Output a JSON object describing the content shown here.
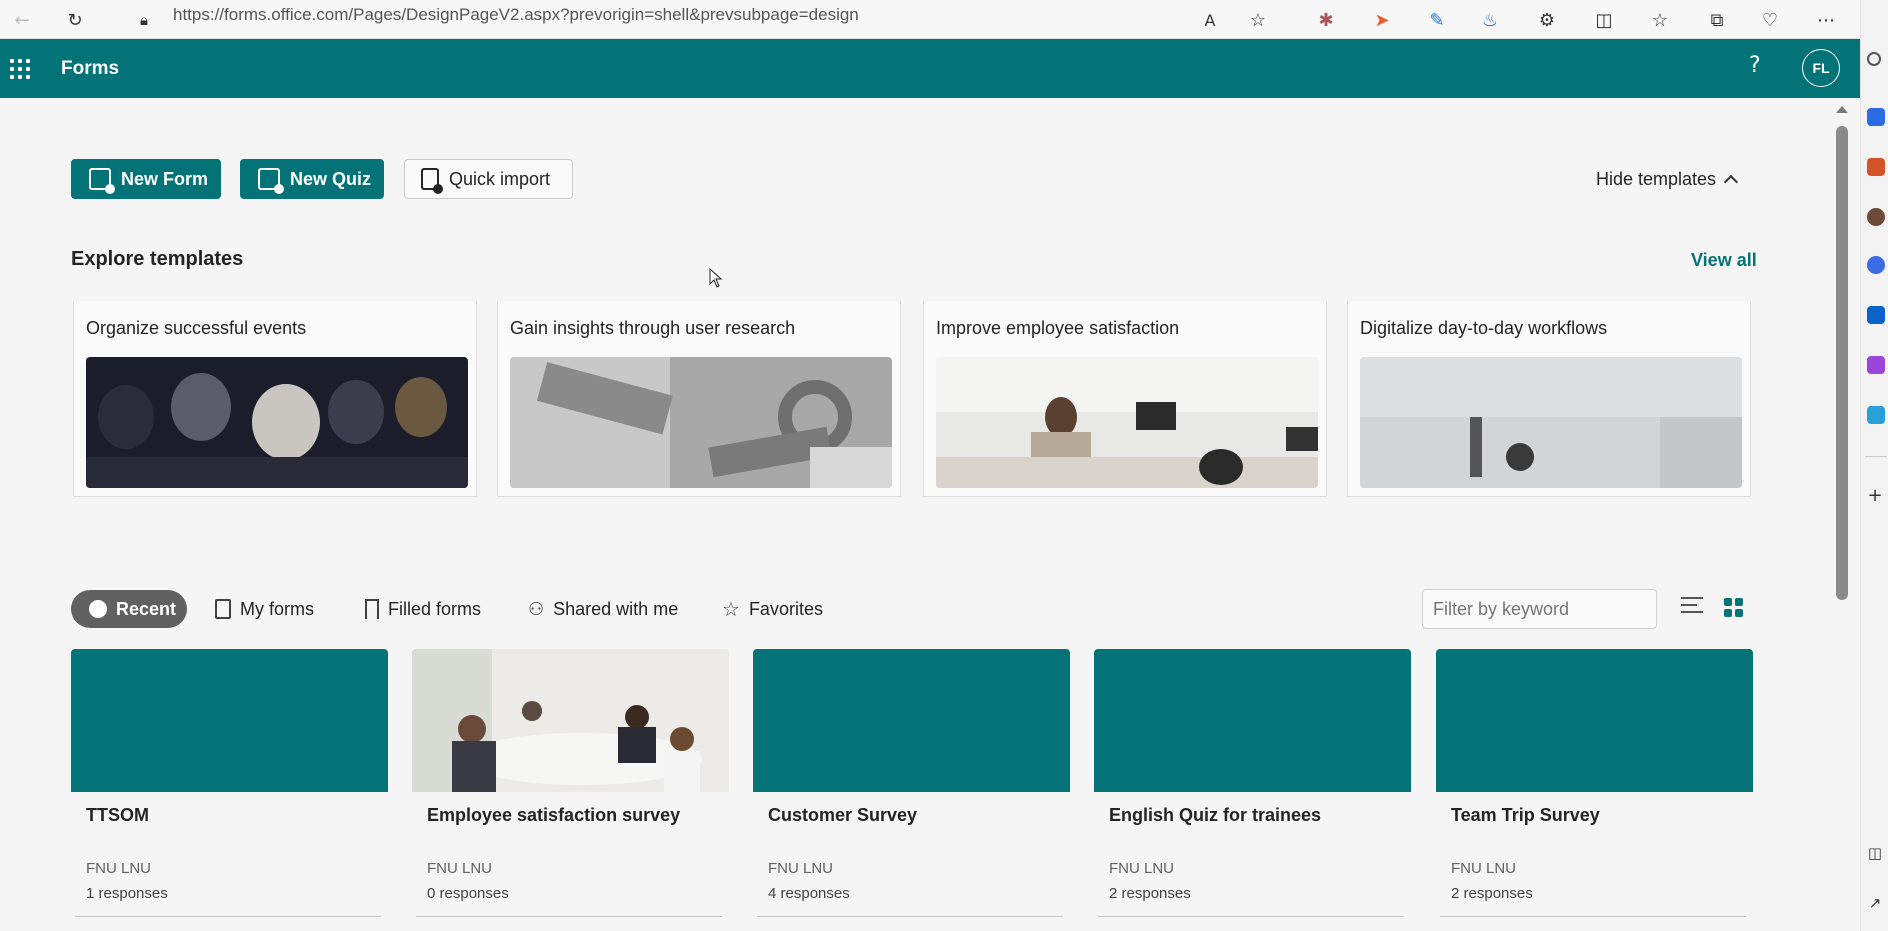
{
  "browser": {
    "url": "https://forms.office.com/Pages/DesignPageV2.aspx?prevorigin=shell&prevsubpage=design"
  },
  "app": {
    "title": "Forms",
    "help": "?",
    "avatar_initials": "FL",
    "accent_color": "#037378"
  },
  "actions": {
    "new_form": "New Form",
    "new_quiz": "New Quiz",
    "quick_import": "Quick import",
    "hide_templates": "Hide templates"
  },
  "templates": {
    "title": "Explore templates",
    "view_all": "View all",
    "cards": [
      {
        "title": "Organize successful events"
      },
      {
        "title": "Gain insights through user research"
      },
      {
        "title": "Improve employee satisfaction"
      },
      {
        "title": "Digitalize day-to-day workflows"
      }
    ]
  },
  "tabs": [
    "Recent",
    "My forms",
    "Filled forms",
    "Shared with me",
    "Favorites"
  ],
  "filter": {
    "placeholder": "Filter by keyword"
  },
  "forms": [
    {
      "title": "TTSOM",
      "owner": "FNU LNU",
      "responses": "1 responses"
    },
    {
      "title": "Employee satisfaction survey",
      "owner": "FNU LNU",
      "responses": "0 responses"
    },
    {
      "title": "Customer Survey",
      "owner": "FNU LNU",
      "responses": "4 responses"
    },
    {
      "title": "English Quiz for trainees",
      "owner": "FNU LNU",
      "responses": "2 responses"
    },
    {
      "title": "Team Trip Survey",
      "owner": "FNU LNU",
      "responses": "2 responses"
    }
  ]
}
